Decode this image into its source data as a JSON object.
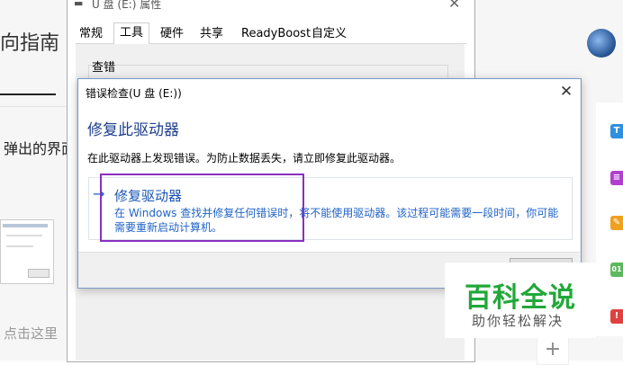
{
  "background_page": {
    "heading": "向指南",
    "body_text": "弹出的界面",
    "click_text": "点击这里"
  },
  "properties_window": {
    "title": "U 盘 (E:) 属性",
    "close_glyph": "✕",
    "tabs": [
      {
        "label": "常规"
      },
      {
        "label": "工具"
      },
      {
        "label": "硬件"
      },
      {
        "label": "共享"
      },
      {
        "label": "ReadyBoost"
      },
      {
        "label": "自定义"
      }
    ],
    "active_tab": "工具",
    "group_label": "查错"
  },
  "dialog": {
    "title": "错误检查(U 盘 (E:))",
    "close_glyph": "✕",
    "heading": "修复此驱动器",
    "message": "在此驱动器上发现错误。为防止数据丢失，请立即修复此驱动器。",
    "action": {
      "arrow": "→",
      "title": "修复驱动器",
      "description": "在 Windows 查找并修复任何错误时，将不能使用驱动器。该过程可能需要一段时间，你可能需要重新启动计算机。"
    }
  },
  "side_toolbar": {
    "icons": [
      {
        "name": "t-icon",
        "glyph": "T",
        "color": "#2f8fe0"
      },
      {
        "name": "doc-icon",
        "glyph": "≡",
        "color": "#b23fd0"
      },
      {
        "name": "wrench-icon",
        "glyph": "✎",
        "color": "#f0a020"
      },
      {
        "name": "binary-icon",
        "glyph": "01",
        "color": "#5cb85c"
      },
      {
        "name": "alert-icon",
        "glyph": "!",
        "color": "#e04040"
      }
    ],
    "plus_glyph": "+"
  },
  "watermark": {
    "main": "百科全说",
    "sub": "助你轻松解决"
  },
  "colors": {
    "highlight": "#8a2fc0",
    "link_blue": "#1b56b4",
    "heading_blue": "#1e3f8c",
    "watermark_green": "#22a83a"
  }
}
